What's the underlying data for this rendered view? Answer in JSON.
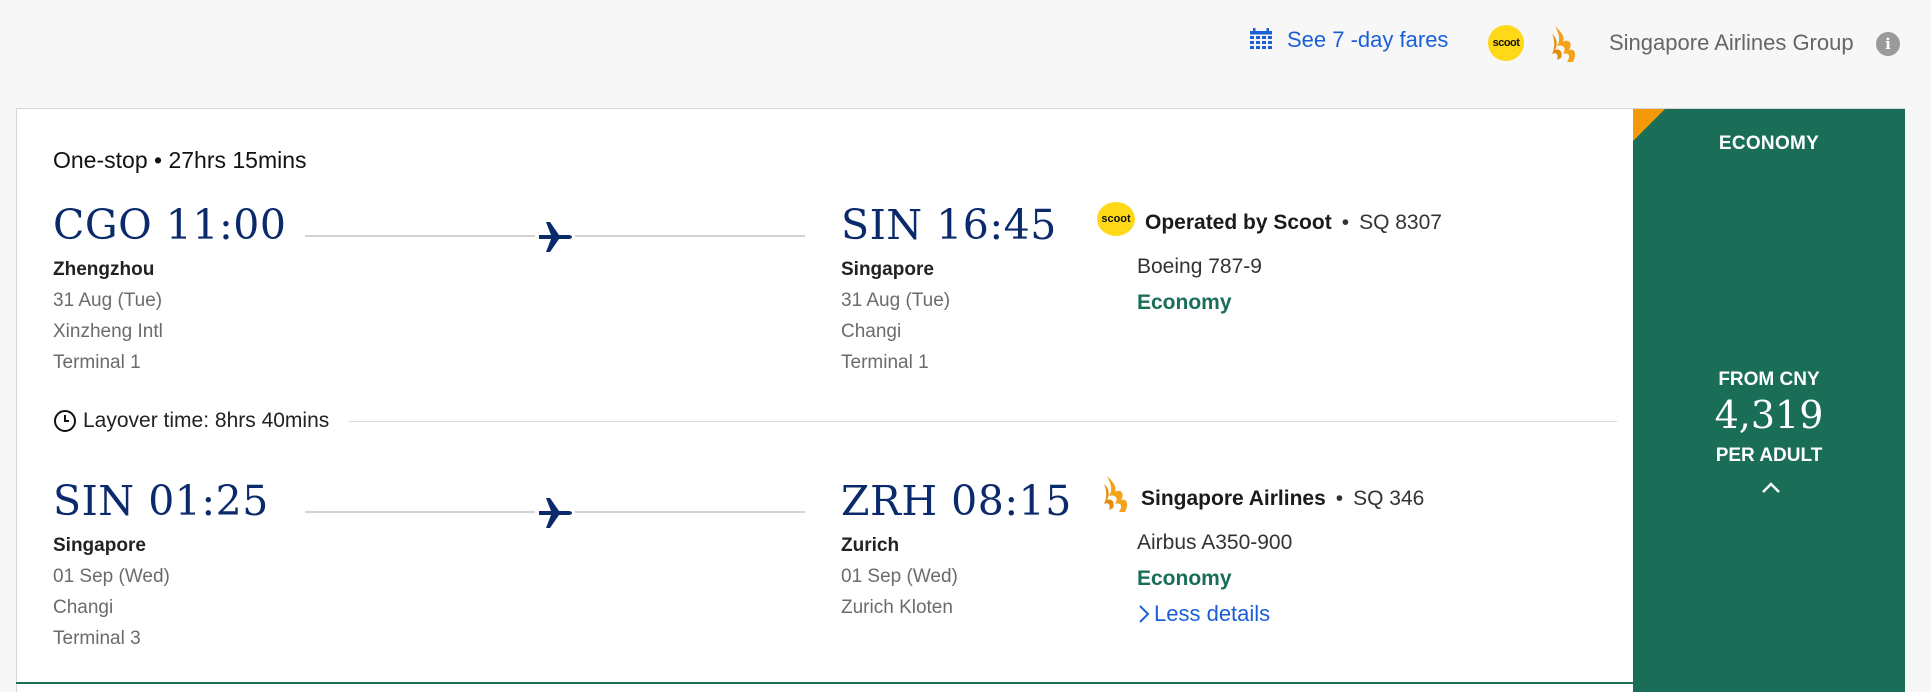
{
  "topbar": {
    "seven_day_label": "See 7 -day fares",
    "group_label": "Singapore Airlines Group",
    "scoot_logo_text": "scoot",
    "info_icon_text": "i"
  },
  "itinerary": {
    "summary": "One-stop • 27hrs 15mins",
    "layover": "Layover time: 8hrs 40mins",
    "segments": [
      {
        "departure": {
          "code_time": "CGO 11:00",
          "city": "Zhengzhou",
          "date": "31 Aug (Tue)",
          "airport": "Xinzheng Intl",
          "terminal": "Terminal 1"
        },
        "arrival": {
          "code_time": "SIN 16:45",
          "city": "Singapore",
          "date": "31 Aug (Tue)",
          "airport": "Changi",
          "terminal": "Terminal 1"
        },
        "carrier": {
          "logo_text": "scoot",
          "operator": "Operated by Scoot",
          "flight_no": "SQ 8307",
          "aircraft": "Boeing 787-9",
          "cabin": "Economy"
        }
      },
      {
        "departure": {
          "code_time": "SIN 01:25",
          "city": "Singapore",
          "date": "01 Sep (Wed)",
          "airport": "Changi",
          "terminal": "Terminal 3"
        },
        "arrival": {
          "code_time": "ZRH 08:15",
          "city": "Zurich",
          "date": "01 Sep (Wed)",
          "airport": "Zurich Kloten"
        },
        "carrier": {
          "operator": "Singapore Airlines",
          "flight_no": "SQ 346",
          "aircraft": "Airbus A350-900",
          "cabin": "Economy",
          "less_details": "Less details"
        }
      }
    ],
    "separator_dot": "•"
  },
  "fare": {
    "cabin_class": "ECONOMY",
    "from_label": "FROM CNY",
    "price": "4,319",
    "per_label": "PER ADULT"
  },
  "colors": {
    "accent_blue": "#1a5fd8",
    "navy": "#0b2a6b",
    "green": "#1a6e57",
    "orange": "#f49a0a",
    "scoot_yellow": "#ffd818"
  },
  "icons": [
    "calendar-icon",
    "scoot-logo",
    "singapore-airlines-logo",
    "info-icon",
    "plane-icon",
    "clock-icon",
    "chevron-right-icon",
    "chevron-up-icon"
  ]
}
